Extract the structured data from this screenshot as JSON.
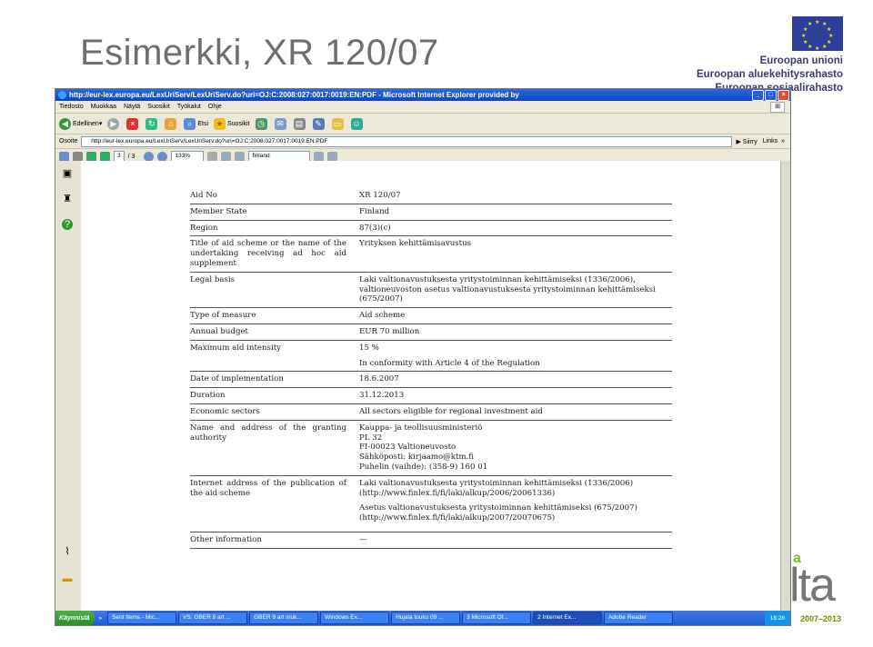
{
  "slide": {
    "title": "Esimerkki, XR 120/07",
    "eu_line1": "Euroopan unioni",
    "eu_line2": "Euroopan aluekehitysrahasto",
    "eu_line3": "Euroopan sosiaalirahasto",
    "logo_letter": "a",
    "logo_word": "lta",
    "logo_years": "2007–2013"
  },
  "browser": {
    "window_title": "http://eur-lex.europa.eu/LexUriServ/LexUriServ.do?uri=OJ:C:2008:027:0017:0019:EN:PDF - Microsoft Internet Explorer provided by",
    "menu": [
      "Tiedosto",
      "Muokkaa",
      "Näytä",
      "Suosikit",
      "Työkalut",
      "Ohje"
    ],
    "back_label": "Edellinen",
    "search_label": "Etsi",
    "favorites_label": "Suosikit",
    "address_label": "Osoite",
    "address": "http://eur-lex.europa.eu/LexUriServ/LexUriServ.do?uri=OJ:C:2008:027:0017:0019:EN:PDF",
    "go_label": "Siirry",
    "links_label": "Links"
  },
  "pdf": {
    "page_current": "3",
    "page_total": "/ 3",
    "zoom": "133%",
    "search_text": "finland"
  },
  "document": {
    "rows": [
      {
        "label": "Aid No",
        "value": [
          "XR 120/07"
        ]
      },
      {
        "label": "Member State",
        "value": [
          "Finland"
        ]
      },
      {
        "label": "Region",
        "value": [
          "87(3)(c)"
        ]
      },
      {
        "label": "Title of aid scheme or the name of the undertaking receiving ad hoc aid supplement",
        "value": [
          "Yrityksen kehittämisavustus"
        ]
      },
      {
        "label": "Legal basis",
        "value": [
          "Laki valtionavustuksesta yritystoiminnan kehittämiseksi (1336/2006), valtioneuvoston asetus valtionavustuksesta yritystoiminnan kehittämiseksi (675/2007)"
        ]
      },
      {
        "label": "Type of measure",
        "value": [
          "Aid scheme"
        ]
      },
      {
        "label": "Annual budget",
        "value": [
          "EUR 70 million"
        ]
      },
      {
        "label": "Maximum aid intensity",
        "value": [
          "15 %"
        ]
      },
      {
        "label": "",
        "value": [
          "In conformity with Article 4 of the Regulation"
        ]
      },
      {
        "label": "Date of implementation",
        "value": [
          "18.6.2007"
        ]
      },
      {
        "label": "Duration",
        "value": [
          "31.12.2013"
        ]
      },
      {
        "label": "Economic sectors",
        "value": [
          "All sectors eligible for regional investment aid"
        ]
      },
      {
        "label": "Name and address of the granting authority",
        "value": [
          "Kauppa- ja teollisuusministeriö",
          "PL 32",
          "FI-00023 Valtioneuvosto",
          "Sähköposti: kirjaamo@ktm.fi",
          "Puhelin (vaihde): (358-9) 160 01"
        ]
      },
      {
        "label": "Internet address of the publication of the aid scheme",
        "value": [
          "Laki valtionavustuksesta yritystoiminnan kehittämiseksi (1336/2006) (http://www.finlex.fi/fi/laki/alkup/2006/20061336)",
          "Asetus valtionavustuksesta yritystoiminnan kehittämiseksi (675/2007) (http://www.finlex.fi/fi/laki/alkup/2007/20070675)"
        ]
      },
      {
        "label": "Other information",
        "value": [
          "—"
        ]
      }
    ]
  },
  "taskbar": {
    "start_label": "Käynnistä",
    "tasks": [
      "Sent Items - Mic...",
      "VS: GBER 9 art ...",
      "GBER 9 art muk...",
      "Windows Ex...",
      "Hujala touko 09 ...",
      "3 Microsoft Of...",
      "2 Internet Ex...",
      "Adobe Reader"
    ],
    "clock": "18:28"
  }
}
